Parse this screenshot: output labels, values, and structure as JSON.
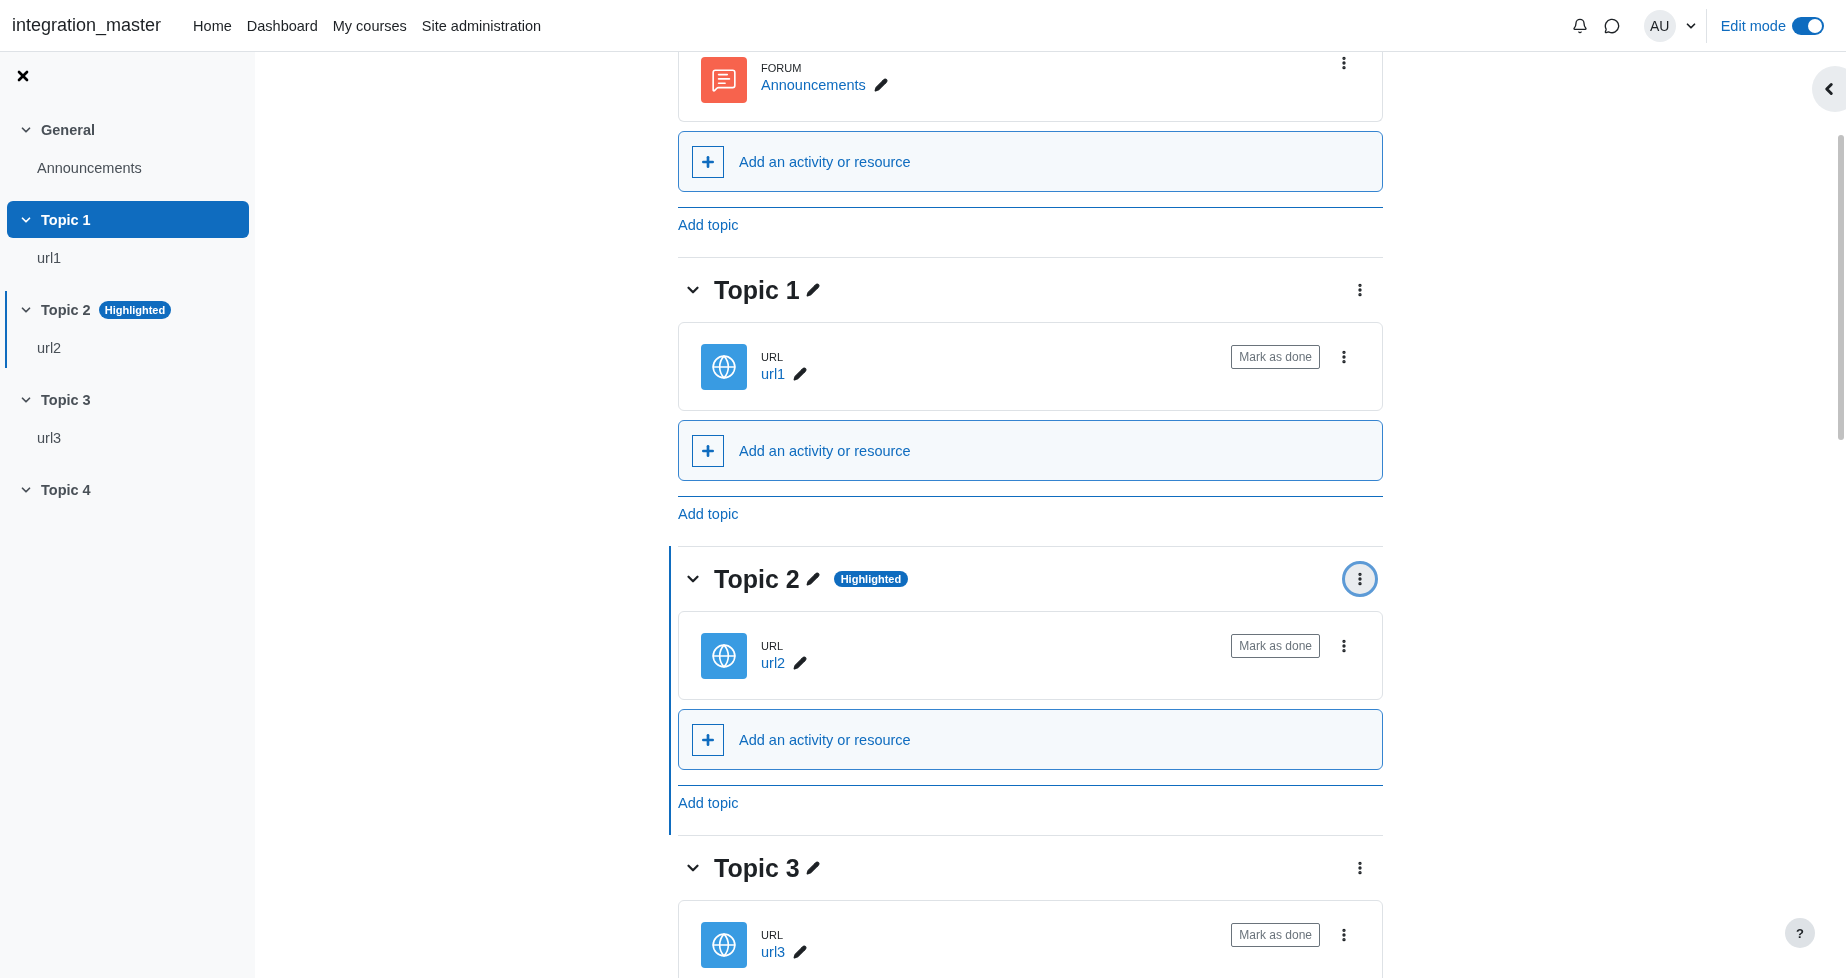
{
  "header": {
    "site_name": "integration_master",
    "nav": [
      {
        "label": "Home"
      },
      {
        "label": "Dashboard"
      },
      {
        "label": "My courses"
      },
      {
        "label": "Site administration"
      }
    ],
    "avatar_initials": "AU",
    "help_label": "?",
    "edit_mode": {
      "label": "Edit mode",
      "on": true
    }
  },
  "sidebar": {
    "items": [
      {
        "title": "General",
        "expanded": true,
        "selected": false,
        "highlighted": false,
        "children": [
          {
            "title": "Announcements"
          }
        ]
      },
      {
        "title": "Topic 1",
        "expanded": true,
        "selected": true,
        "highlighted": false,
        "children": [
          {
            "title": "url1"
          }
        ]
      },
      {
        "title": "Topic 2",
        "expanded": true,
        "selected": false,
        "highlighted": true,
        "badge": "Highlighted",
        "children": [
          {
            "title": "url2"
          }
        ]
      },
      {
        "title": "Topic 3",
        "expanded": true,
        "selected": false,
        "highlighted": false,
        "children": [
          {
            "title": "url3"
          }
        ]
      },
      {
        "title": "Topic 4",
        "expanded": true,
        "selected": false,
        "highlighted": false
      }
    ]
  },
  "sections": [
    {
      "highlighted": false,
      "activities": [
        {
          "kind": "forum",
          "type_label": "FORUM",
          "name": "Announcements"
        }
      ],
      "add_label": "Add an activity or resource",
      "add_topic": "Add topic"
    },
    {
      "title": "Topic 1",
      "expanded": true,
      "highlighted": false,
      "menu_focused": false,
      "activities": [
        {
          "kind": "url",
          "type_label": "URL",
          "name": "url1",
          "completion": "Mark as done"
        }
      ],
      "add_label": "Add an activity or resource",
      "add_topic": "Add topic"
    },
    {
      "title": "Topic 2",
      "expanded": true,
      "highlighted": true,
      "badge": "Highlighted",
      "menu_focused": true,
      "activities": [
        {
          "kind": "url",
          "type_label": "URL",
          "name": "url2",
          "completion": "Mark as done"
        }
      ],
      "add_label": "Add an activity or resource",
      "add_topic": "Add topic"
    },
    {
      "title": "Topic 3",
      "expanded": true,
      "highlighted": false,
      "menu_focused": false,
      "activities": [
        {
          "kind": "url",
          "type_label": "URL",
          "name": "url3",
          "completion": "Mark as done"
        }
      ]
    }
  ]
}
